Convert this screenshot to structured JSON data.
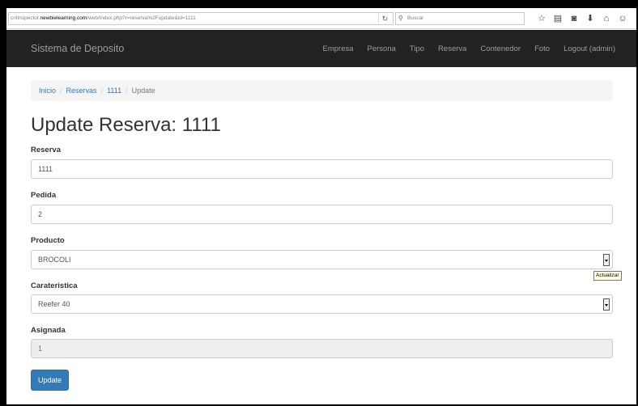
{
  "browser": {
    "url_host_prefix": "cntinspector.",
    "url_host": "newbielearning.com",
    "url_path": "/web/index.php?r=reserva%2Fupdate&id=1111",
    "search_placeholder": "Buscar"
  },
  "navbar": {
    "brand": "Sistema de Deposito",
    "items": [
      "Empresa",
      "Persona",
      "Tipo",
      "Reserva",
      "Contenedor",
      "Foto",
      "Logout (admin)"
    ]
  },
  "breadcrumb": {
    "items": [
      "Inicio",
      "Reservas",
      "1111"
    ],
    "active": "Update"
  },
  "page_title": "Update Reserva: 1111",
  "form": {
    "reserva": {
      "label": "Reserva",
      "value": "1111"
    },
    "pedida": {
      "label": "Pedida",
      "value": "2"
    },
    "producto": {
      "label": "Producto",
      "value": "BROCOLI"
    },
    "carateristica": {
      "label": "Carateristica",
      "value": "Reefer 40"
    },
    "asignada": {
      "label": "Asignada",
      "value": "1"
    }
  },
  "tooltip": "Actualizar",
  "submit_label": "Update",
  "colors": {
    "navbar": "#222222",
    "link": "#337ab7",
    "primary_button": "#337ab7"
  }
}
